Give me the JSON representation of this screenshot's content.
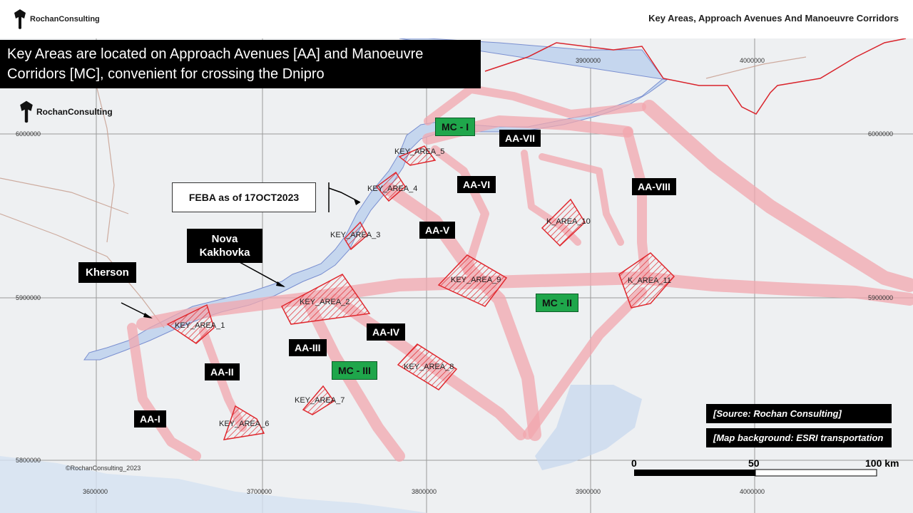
{
  "header": {
    "brand": "RochanConsulting",
    "title": "Key Areas, Approach Avenues And Manoeuvre Corridors"
  },
  "banner": {
    "line1": "Key Areas are located on Approach Avenues [AA] and Manoeuvre",
    "line2": "Corridors [MC], convenient for crossing the Dnipro"
  },
  "map_brand": "RochanConsulting",
  "feba": "FEBA as of 17OCT2023",
  "cities": {
    "kherson": "Kherson",
    "nova_line1": "Nova",
    "nova_line2": "Kakhovka"
  },
  "approach_avenues": [
    "AA-I",
    "AA-II",
    "AA-III",
    "AA-IV",
    "AA-V",
    "AA-VI",
    "AA-VII",
    "AA-VIII"
  ],
  "corridors": [
    "MC - I",
    "MC - II",
    "MC - III"
  ],
  "key_areas": [
    "KEY_AREA_1",
    "KEY_AREA_2",
    "KEY_AREA_3",
    "KEY_AREA_4",
    "KEY_AREA_5",
    "KEY_AREA_6",
    "KEY_AREA_7",
    "KEY_AREA_8",
    "KEY_AREA_9",
    "K_AREA_10",
    "K_AREA_11"
  ],
  "coords_y": [
    "6000000",
    "5900000",
    "5800000"
  ],
  "coords_x": [
    "3600000",
    "3700000",
    "3800000",
    "3900000",
    "4000000"
  ],
  "coords_top": [
    "3900000",
    "4000000"
  ],
  "coords_right": [
    "6000000",
    "5900000"
  ],
  "sources": {
    "s1": "[Source: Rochan Consulting]",
    "s2": "[Map background: ESRI transportation"
  },
  "scale": {
    "l0": "0",
    "l50": "50",
    "l100": "100 km"
  },
  "credit": "©RochanConsulting_2023",
  "colors": {
    "corridor": "#f0a4aa",
    "keyarea": "#e0282e",
    "water": "#b9cde9",
    "mc": "#1fa64b"
  }
}
